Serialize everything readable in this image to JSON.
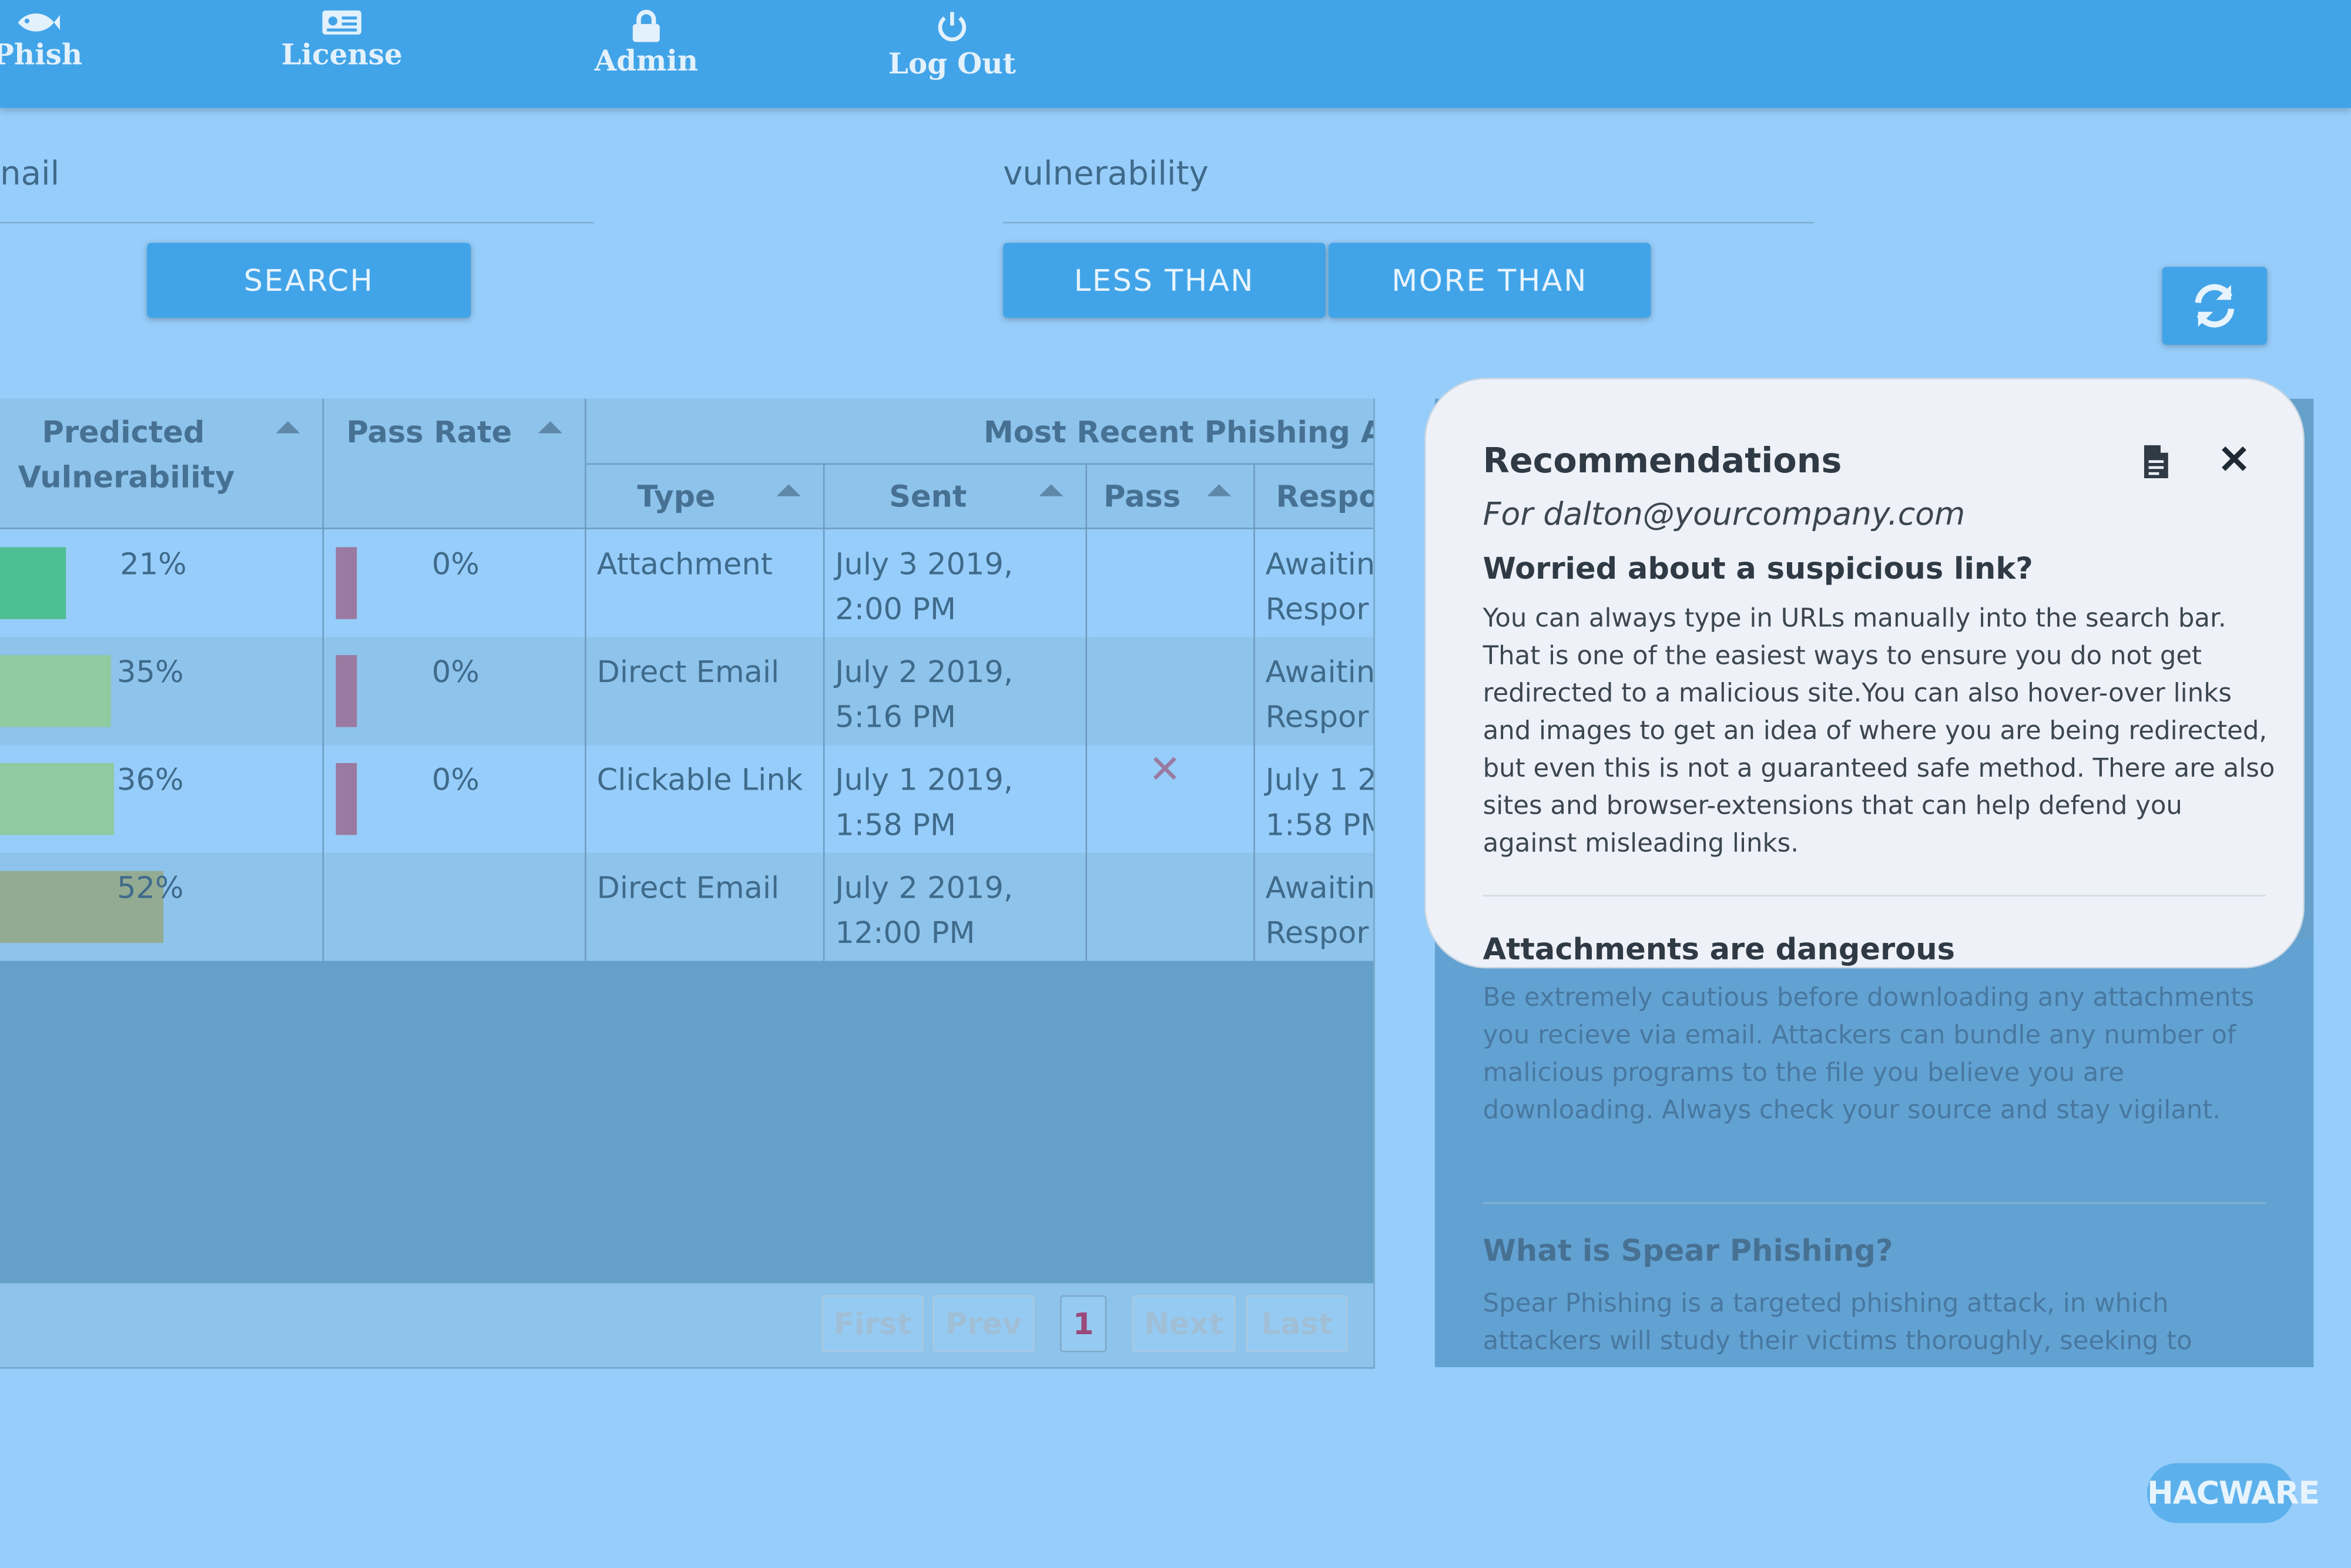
{
  "nav": {
    "items": [
      {
        "label": "Phish",
        "icon": "fish-icon"
      },
      {
        "label": "License",
        "icon": "id-card-icon"
      },
      {
        "label": "Admin",
        "icon": "lock-icon"
      },
      {
        "label": "Log Out",
        "icon": "power-icon"
      }
    ]
  },
  "search": {
    "email_field_value": "nail",
    "search_button": "SEARCH",
    "vulnerability_field_value": "vulnerability",
    "less_than_button": "LESS THAN",
    "more_than_button": "MORE THAN",
    "refresh_icon": "refresh-icon"
  },
  "table": {
    "headers": {
      "predicted_vulnerability_1": "Predicted",
      "predicted_vulnerability_2": "Vulnerability",
      "pass_rate": "Pass Rate",
      "most_recent": "Most Recent Phishing At",
      "type": "Type",
      "sent": "Sent",
      "pass": "Pass",
      "response": "Respo"
    },
    "rows": [
      {
        "vuln": "21%",
        "vuln_fraction": 0.21,
        "vuln_color": "#4dbf92",
        "pass_rate": "0%",
        "type": "Attachment",
        "sent_1": "July 3 2019,",
        "sent_2": "2:00 PM",
        "pass": "",
        "resp_1": "Awaitin",
        "resp_2": "Respor"
      },
      {
        "vuln": "35%",
        "vuln_fraction": 0.35,
        "vuln_color": "#8fcaa0",
        "pass_rate": "0%",
        "type": "Direct Email",
        "sent_1": "July 2 2019,",
        "sent_2": "5:16 PM",
        "pass": "",
        "resp_1": "Awaitin",
        "resp_2": "Respor"
      },
      {
        "vuln": "36%",
        "vuln_fraction": 0.36,
        "vuln_color": "#8fcaa0",
        "pass_rate": "0%",
        "type": "Clickable Link",
        "sent_1": "July 1 2019,",
        "sent_2": "1:58 PM",
        "pass": "✕",
        "resp_1": "July 1 2",
        "resp_2": "1:58 PM"
      },
      {
        "vuln": "52%",
        "vuln_fraction": 0.52,
        "vuln_color": "#93ab93",
        "pass_rate": "",
        "type": "Direct Email",
        "sent_1": "July 2 2019,",
        "sent_2": "12:00 PM",
        "pass": "",
        "resp_1": "Awaitin",
        "resp_2": "Respor"
      }
    ],
    "pagination": {
      "first": "First",
      "prev": "Prev",
      "current": "1",
      "next": "Next",
      "last": "Last"
    }
  },
  "recommendations": {
    "title": "Recommendations",
    "for_line": "For dalton@yourcompany.com",
    "sections": [
      {
        "heading": "Worried about a suspicious link?",
        "body": "You can always type in URLs manually into the search bar. That is one of the easiest ways to ensure you do not get redirected to a malicious site.You can also hover-over links and images to get an idea of where you are being redirected, but even this is not a guaranteed safe method. There are also sites and browser-extensions that can help defend you against misleading links."
      },
      {
        "heading": "Attachments are dangerous",
        "body": "Be extremely cautious before downloading any attachments you recieve via email. Attackers can bundle any number of malicious programs to the file you believe you are downloading. Always check your source and stay vigilant."
      },
      {
        "heading": "What is Spear Phishing?",
        "body": "Spear Phishing is a targeted phishing attack, in which attackers will study their victims thoroughly, seeking to"
      }
    ]
  },
  "logo": {
    "text": "HACWARE"
  },
  "colors": {
    "nav": "#42a4e8",
    "page": "#97cdfa",
    "pass_bar": "#9a7aa0"
  }
}
